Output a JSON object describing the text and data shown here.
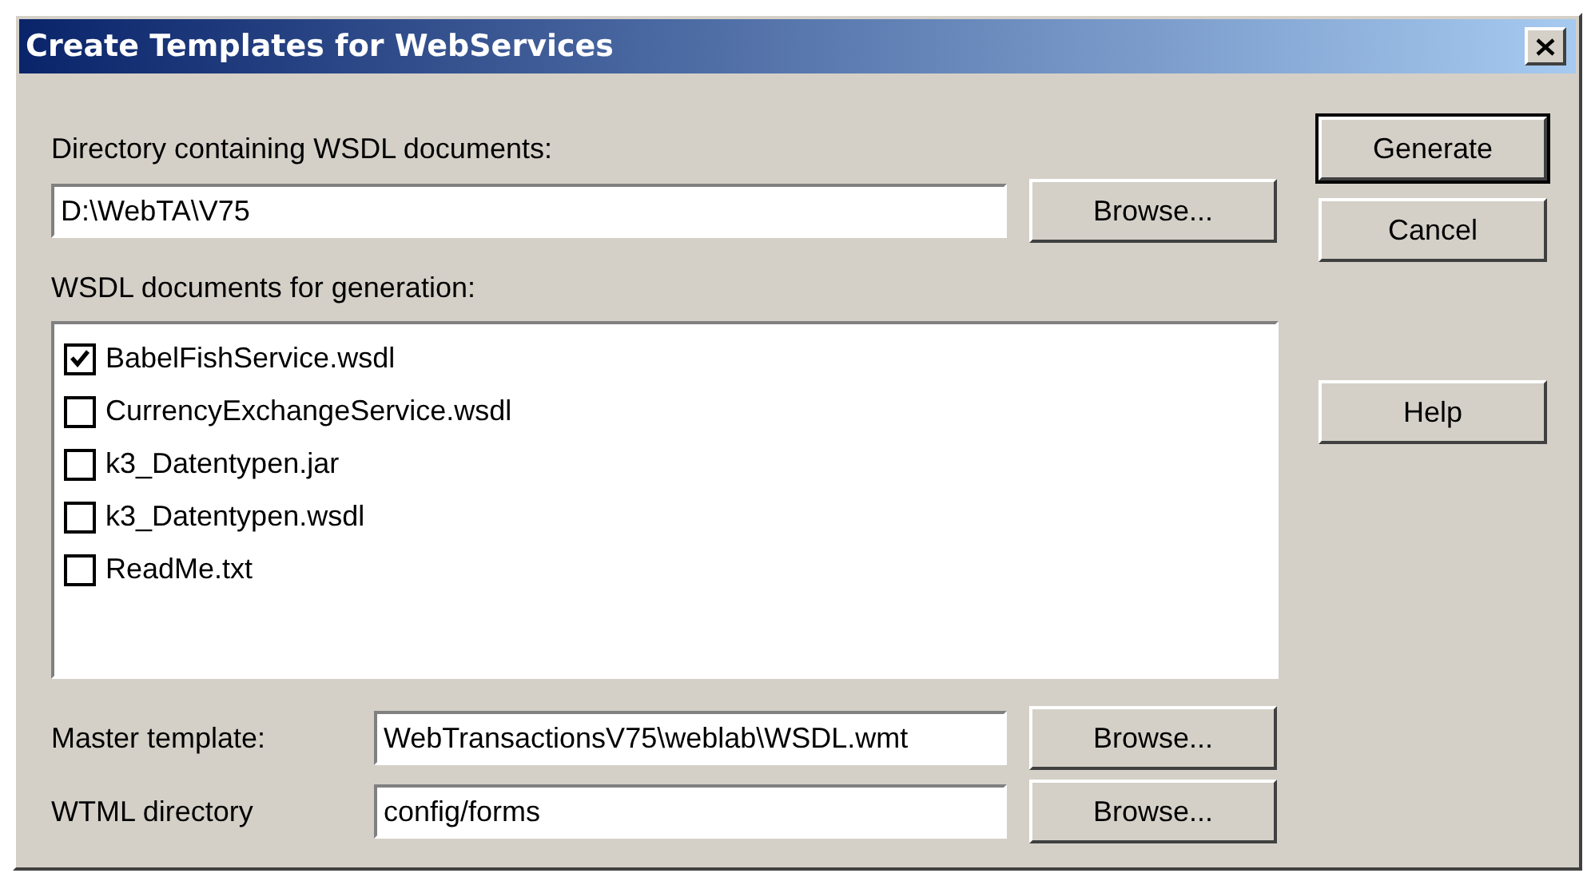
{
  "window": {
    "title": "Create Templates for WebServices"
  },
  "directory": {
    "label": "Directory containing WSDL documents:",
    "value": "D:\\WebTA\\V75",
    "button": "Browse..."
  },
  "documents": {
    "label": "WSDL documents for generation:",
    "items": [
      {
        "label": "BabelFishService.wsdl",
        "checked": true
      },
      {
        "label": "CurrencyExchangeService.wsdl",
        "checked": false
      },
      {
        "label": "k3_Datentypen.jar",
        "checked": false
      },
      {
        "label": "k3_Datentypen.wsdl",
        "checked": false
      },
      {
        "label": "ReadMe.txt",
        "checked": false
      }
    ]
  },
  "fields": [
    {
      "label": "Master template:",
      "value": "WebTransactionsV75\\weblab\\WSDL.wmt",
      "button": "Browse..."
    },
    {
      "label": "WTML directory",
      "value": "config/forms",
      "button": "Browse..."
    }
  ],
  "buttons": [
    {
      "label": "Generate",
      "default": true,
      "kind": "top"
    },
    {
      "label": "Cancel",
      "default": false,
      "kind": "top"
    },
    {
      "label": "Help",
      "default": false,
      "kind": "bottom"
    }
  ]
}
